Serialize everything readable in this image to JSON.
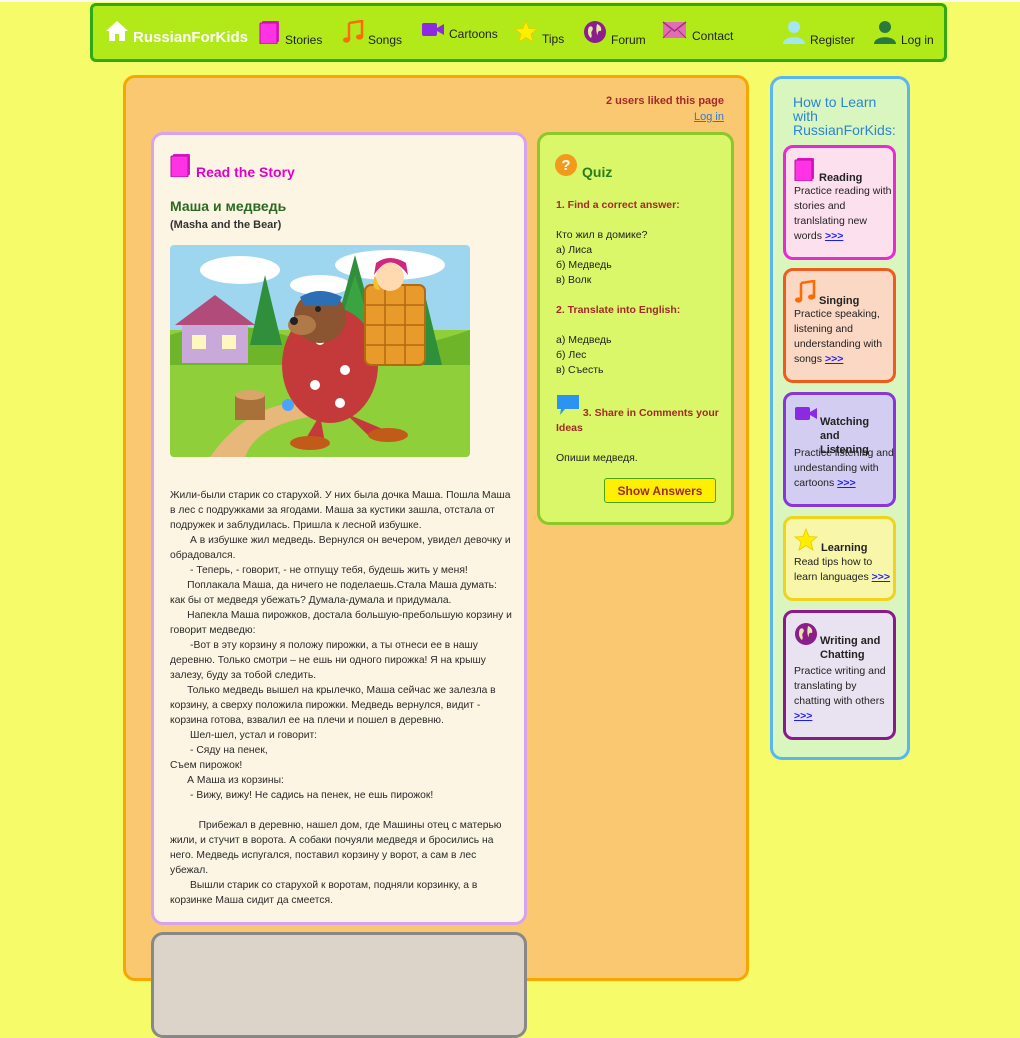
{
  "nav": {
    "brand": "RussianForKids",
    "items": [
      {
        "label": "Stories"
      },
      {
        "label": "Songs"
      },
      {
        "label": "Cartoons"
      },
      {
        "label": "Tips"
      },
      {
        "label": "Forum"
      },
      {
        "label": "Contact"
      }
    ],
    "register": "Register",
    "login": "Log in"
  },
  "page": {
    "likes": "2 users liked this page",
    "login_link": "Log in"
  },
  "story": {
    "heading": "Read the Story",
    "title": "Маша и медведь",
    "subtitle": "(Masha and the Bear)",
    "paragraphs": [
      "Жили-были старик со старухой. У них была дочка Маша. Пошла Маша в лес с подружками за ягодами. Маша за кустики зашла, отстала от подружек и заблудилась. Пришла к лесной избушке.",
      "       А в избушке жил медведь. Вернулся он вечером, увидел девочку и обрадовался.",
      "       - Теперь, - говорит, - не отпущу тебя, будешь жить у меня!",
      "      Поплакала Маша, да ничего не поделаешь.Стала Маша думать: как бы от медведя убежать? Думала-думала и придумала.",
      "      Напекла Маша пирожков, достала большую-пребольшую корзину и говорит медведю:",
      "       -Вот в эту корзину я положу пирожки, а ты отнеси ее в нашу деревню. Только смотри – не ешь ни одного пирожка! Я на крышу залезу, буду за тобой следить.",
      "      Только медведь вышел на крылечко, Маша сейчас же залезла в корзину, а сверху положила пирожки. Медведь вернулся, видит - корзина готова, взвалил ее на плечи и пошел в деревню.",
      "       Шел-шел, устал и говорит:",
      "       - Сяду на пенек,",
      "Съем пирожок!",
      "      А Маша из корзины:",
      "       - Вижу, вижу! Не садись на пенек, не ешь пирожок!",
      " ",
      "          Прибежал в деревню, нашел дом, где Машины отец с матерью жили, и стучит в ворота. А собаки почуяли медведя и бросились на него. Медведь испугался, поставил корзину у ворот, а сам в лес убежал.",
      "       Вышли старик со старухой к воротам, подняли корзинку, а в корзинке Маша сидит да смеется."
    ]
  },
  "quiz": {
    "heading": "Quiz",
    "q1_title": "1. Find a correct answer:",
    "q1_question": "Кто жил в домике?",
    "q1_options": [
      "а) Лиса",
      "б) Медведь",
      "в) Волк"
    ],
    "q2_title": "2. Translate into English:",
    "q2_options": [
      "а) Медведь",
      "б) Лес",
      "в) Съесть"
    ],
    "q3_title": "3. Share in Comments your Ideas",
    "q3_prompt": "Опиши медведя.",
    "show_answers": "Show Answers"
  },
  "sidebar": {
    "title": "How to Learn with RussianForKids:",
    "more": ">>>",
    "cards": [
      {
        "title": "Reading",
        "desc": "Practice reading with stories and tranlslating new words",
        "bg": "#fde0ee",
        "border": "#e82ad3"
      },
      {
        "title": "Singing",
        "desc": "Practice speaking, listening and understanding with songs",
        "bg": "#fad8c4",
        "border": "#ef5b1b"
      },
      {
        "title": "Watching and Listening",
        "desc": "Practice listening and undestanding with cartoons",
        "bg": "#d4cdf2",
        "border": "#8a35dc"
      },
      {
        "title": "Learning",
        "desc": "Read tips how to learn languages",
        "bg": "#f8f6a8",
        "border": "#f2d31c"
      },
      {
        "title": "Writing and Chatting",
        "desc": "Practice writing and translating by chatting with others",
        "bg": "#e9e2f0",
        "border": "#8a1a8c"
      }
    ]
  }
}
